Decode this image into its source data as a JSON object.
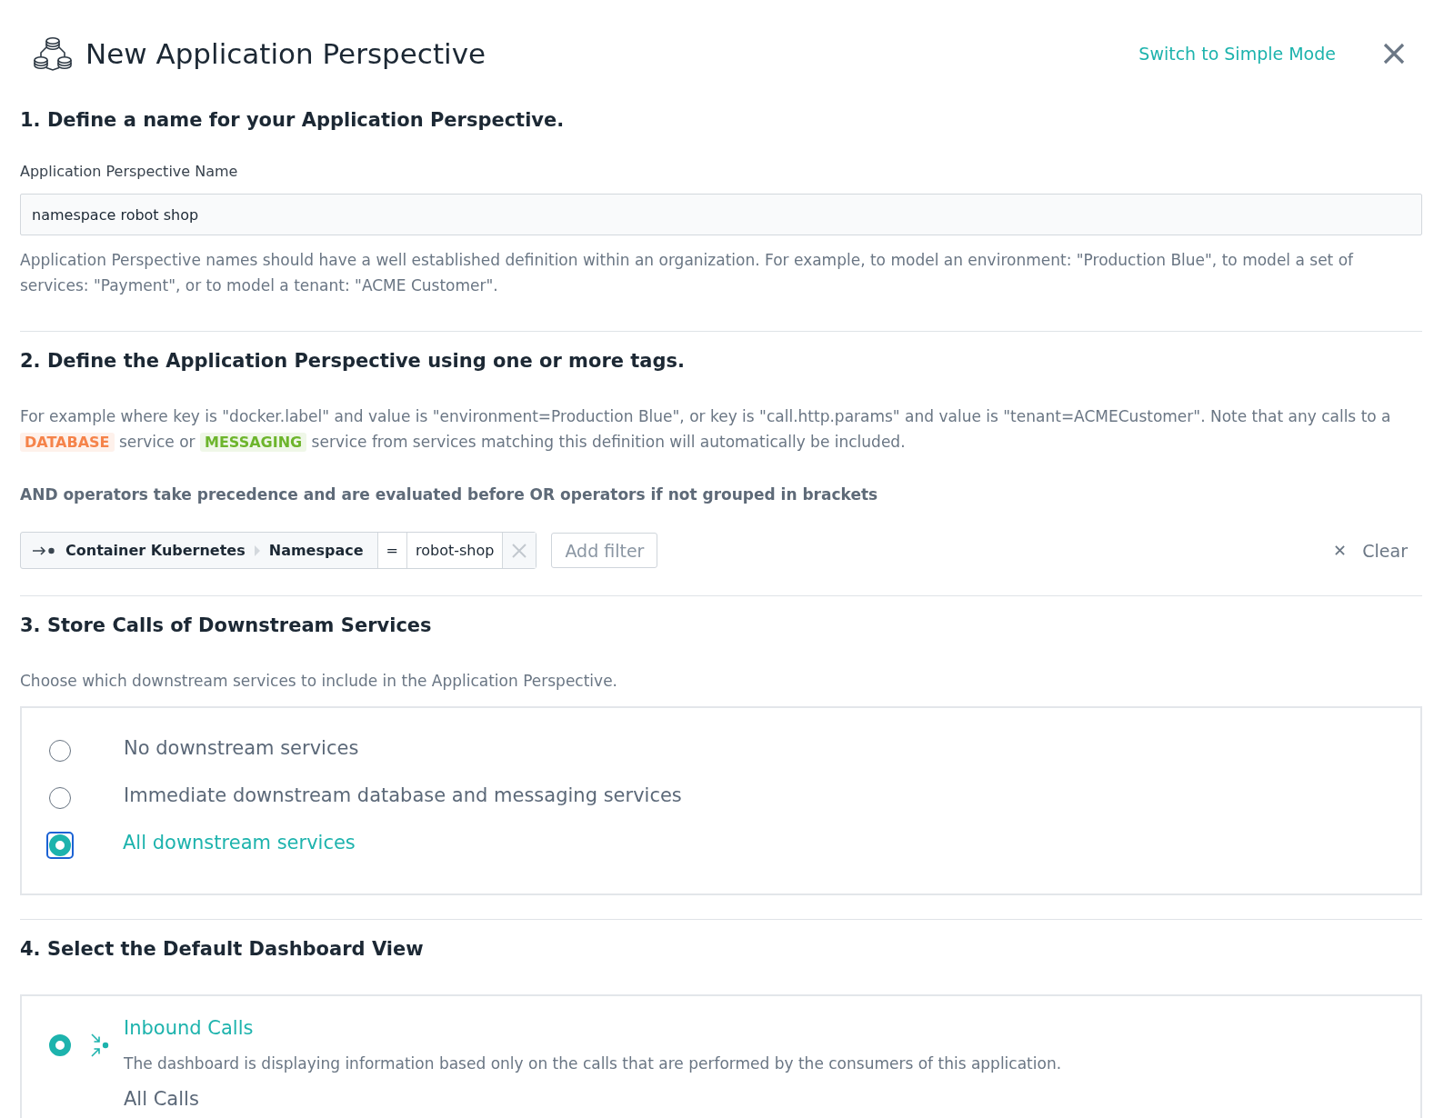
{
  "header": {
    "title": "New Application Perspective",
    "mode_link": "Switch to Simple Mode"
  },
  "section_1": {
    "heading": "1. Define a name for your Application Perspective.",
    "field_label": "Application Perspective Name",
    "field_value": "namespace robot shop",
    "help": "Application Perspective names should have a well established definition within an organization. For example, to model an environment: \"Production Blue\", to model a set of services: \"Payment\", or to model a tenant: \"ACME Customer\"."
  },
  "section_2": {
    "heading": "2. Define the Application Perspective using one or more tags.",
    "example_parts": [
      {
        "kind": "text",
        "text": "For example where key is \"docker.label\" and value is \"environment=Production Blue\", or key is \"call.http.params\" and value is \"tenant=ACMECustomer\". Note that any calls to a "
      },
      {
        "kind": "tag",
        "text": "DATABASE",
        "color": "#f5834a"
      },
      {
        "kind": "text",
        "text": " service or "
      },
      {
        "kind": "tag",
        "text": "MESSAGING",
        "color": "#6db52c"
      },
      {
        "kind": "text",
        "text": " service from services matching this definition will automatically be included."
      }
    ],
    "note": "AND operators take precedence and are evaluated before OR operators if not grouped in brackets",
    "filter": {
      "entity": "Container Kubernetes",
      "tag": "Namespace",
      "operator": "=",
      "value": "robot-shop"
    },
    "add_filter": "Add filter",
    "clear": "Clear"
  },
  "section_3": {
    "heading": "3. Store Calls of Downstream Services",
    "description": "Choose which downstream services to include in the Application Perspective.",
    "options": [
      {
        "label": "No downstream services",
        "selected": false,
        "focused": false
      },
      {
        "label": "Immediate downstream database and messaging services",
        "selected": false,
        "focused": false
      },
      {
        "label": "All downstream services",
        "selected": true,
        "focused": true
      }
    ]
  },
  "section_4": {
    "heading": "4. Select the Default Dashboard View",
    "options": [
      {
        "kind": "inbound",
        "title": "Inbound Calls",
        "description": "The dashboard is displaying information based only on the calls that are performed by the consumers of this application.",
        "selected": true
      },
      {
        "kind": "all",
        "title": "All Calls"
      }
    ]
  }
}
